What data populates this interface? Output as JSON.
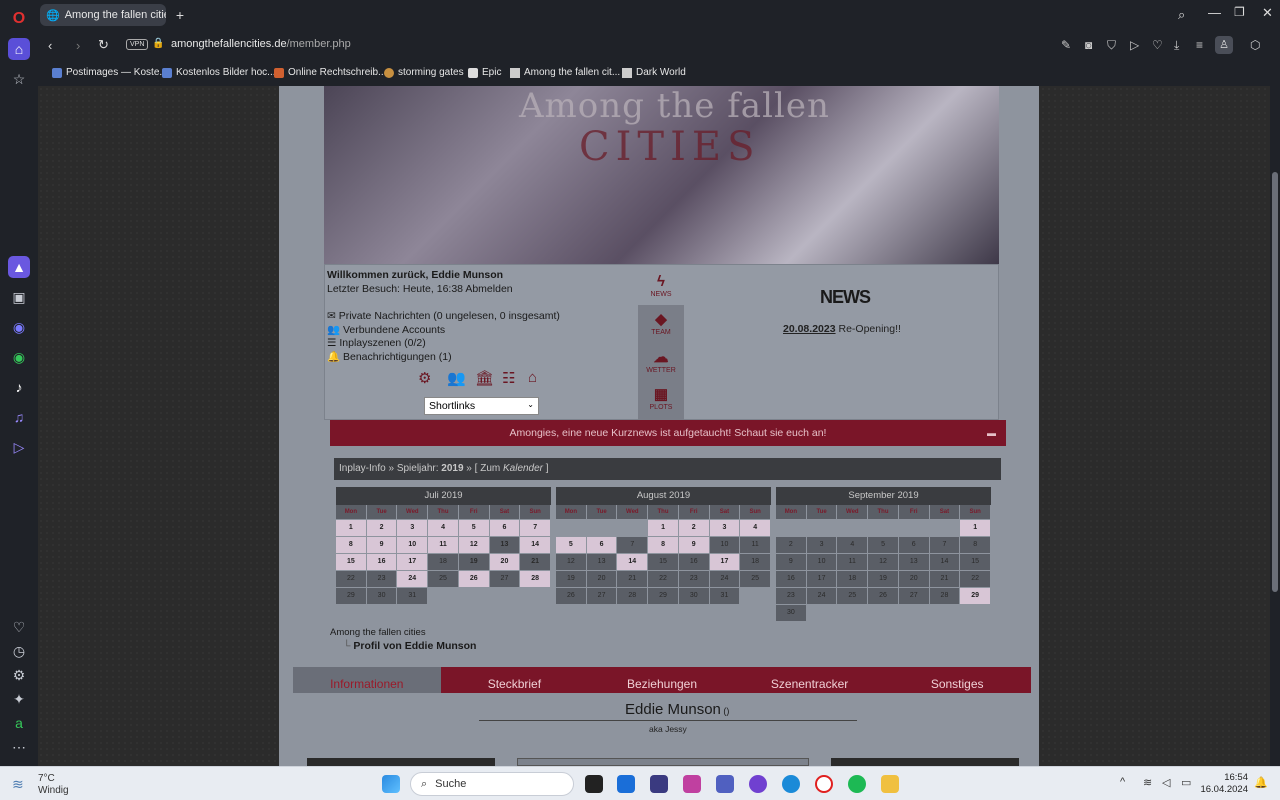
{
  "browser": {
    "tab_title": "Among the fallen cities - F",
    "url_domain": "amongthefallencities.de",
    "url_path": "/member.php",
    "vpn_label": "VPN",
    "bookmarks": [
      "Postimages — Koste...",
      "Kostenlos Bilder hoc...",
      "Online Rechtschreib...",
      "storming gates",
      "Epic",
      "Among the fallen cit...",
      "Dark World"
    ]
  },
  "header": {
    "logo_line1": "Among the fallen",
    "logo_line2": "CITIES"
  },
  "welcome": {
    "greeting": "Willkommen zurück, Eddie Munson",
    "last_visit": "Letzter Besuch: Heute, 16:38 Abmelden",
    "pm": "Private Nachrichten (0 ungelesen, 0 insgesamt)",
    "accounts": "Verbundene Accounts",
    "inplay": "Inplayszenen (0/2)",
    "notifications": "Benachrichtigungen (1)",
    "shortlinks": "Shortlinks"
  },
  "news_menu": {
    "news": "NEWS",
    "team": "TEAM",
    "wetter": "WETTER",
    "plots": "PLOTS"
  },
  "news": {
    "title": "NEWS",
    "date": "20.08.2023",
    "text": " Re-Opening!!"
  },
  "banner": "Amongies, eine neue Kurznews ist aufgetaucht! Schaut sie euch an!",
  "inplay_info": {
    "prefix": "Inplay-Info » Spieljahr: ",
    "year": "2019",
    "suffix": " » [ Zum ",
    "link": "Kalender",
    "end": " ]"
  },
  "calendar": {
    "weekdays": [
      "Mon",
      "Tue",
      "Wed",
      "Thu",
      "Fri",
      "Sat",
      "Sun"
    ],
    "months": [
      {
        "name": "Juli 2019",
        "offset": 0,
        "days": 31,
        "highlighted": [
          1,
          2,
          3,
          4,
          5,
          6,
          7,
          8,
          9,
          10,
          11,
          12,
          14,
          15,
          16,
          17,
          20,
          24,
          26,
          28
        ],
        "bold": [
          13,
          19,
          21
        ]
      },
      {
        "name": "August 2019",
        "offset": 3,
        "days": 31,
        "highlighted": [
          1,
          2,
          3,
          4,
          5,
          6,
          8,
          9,
          14,
          17
        ],
        "bold": []
      },
      {
        "name": "September 2019",
        "offset": 6,
        "days": 30,
        "highlighted": [
          1,
          29
        ],
        "bold": []
      }
    ]
  },
  "breadcrumb": {
    "root": "Among the fallen cities",
    "current": "Profil von Eddie Munson"
  },
  "profile_tabs": [
    "Informationen",
    "Steckbrief",
    "Beziehungen",
    "Szenentracker",
    "Sonstiges"
  ],
  "profile": {
    "name": "Eddie Munson",
    "name_suffix": " ()",
    "aka": "aka Jessy"
  },
  "taskbar": {
    "temp": "7°C",
    "condition": "Windig",
    "search": "Suche",
    "time": "16:54",
    "date": "16.04.2024"
  }
}
